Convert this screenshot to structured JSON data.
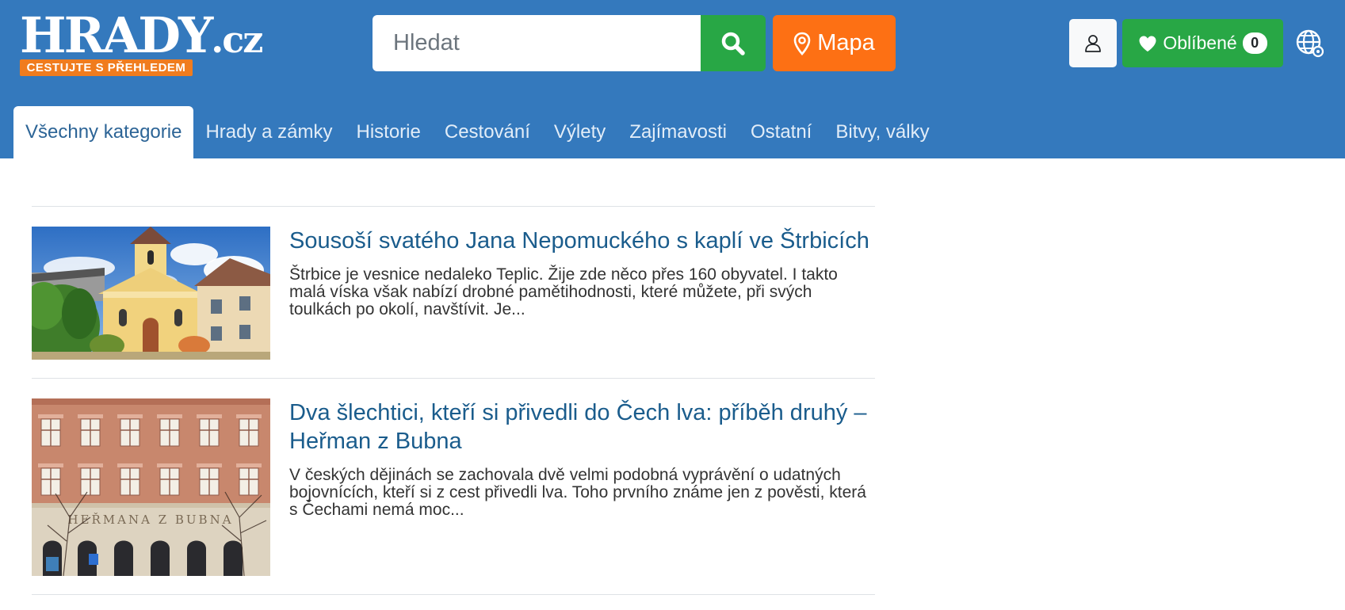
{
  "brand": {
    "color": "#3479bd",
    "logo_main": "HRADY",
    "logo_suffix": ".cz",
    "tagline": "CESTUJTE S PŘEHLEDEM"
  },
  "search": {
    "placeholder": "Hledat",
    "value": "",
    "icon": "search-icon"
  },
  "map_button": {
    "label": "Mapa",
    "icon": "map-pin-icon"
  },
  "account": {
    "icon": "user-icon"
  },
  "favorites": {
    "label": "Oblíbené",
    "count": "0",
    "icon": "heart-icon"
  },
  "language": {
    "icon": "globe-icon"
  },
  "nav": {
    "items": [
      {
        "label": "Všechny kategorie",
        "active": true
      },
      {
        "label": "Hrady a zámky"
      },
      {
        "label": "Historie"
      },
      {
        "label": "Cestování"
      },
      {
        "label": "Výlety"
      },
      {
        "label": "Zajímavosti"
      },
      {
        "label": "Ostatní"
      },
      {
        "label": "Bitvy, války"
      }
    ]
  },
  "articles": [
    {
      "title": "Sousoší svatého Jana Nepomuckého s kaplí ve Štrbicích",
      "excerpt": "Štrbice je vesnice nedaleko Teplic. Žije zde něco přes 160 obyvatel. I takto malá víska však nabízí drobné pamětihodnosti, které můžete, při svých toulkách po okolí, navštívit. Je..."
    },
    {
      "title": "Dva šlechtici, kteří si přivedli do Čech lva: příběh druhý – Heřman z Bubna",
      "excerpt": "V českých dějinách se zachovala dvě velmi podobná vyprávění o udatných bojovnících, kteří si z cest přivedli lva. Toho prvního známe jen z pověsti, která s Čechami nemá moc...",
      "image_inscription": "HEŘMANA Z BUBNA"
    }
  ]
}
